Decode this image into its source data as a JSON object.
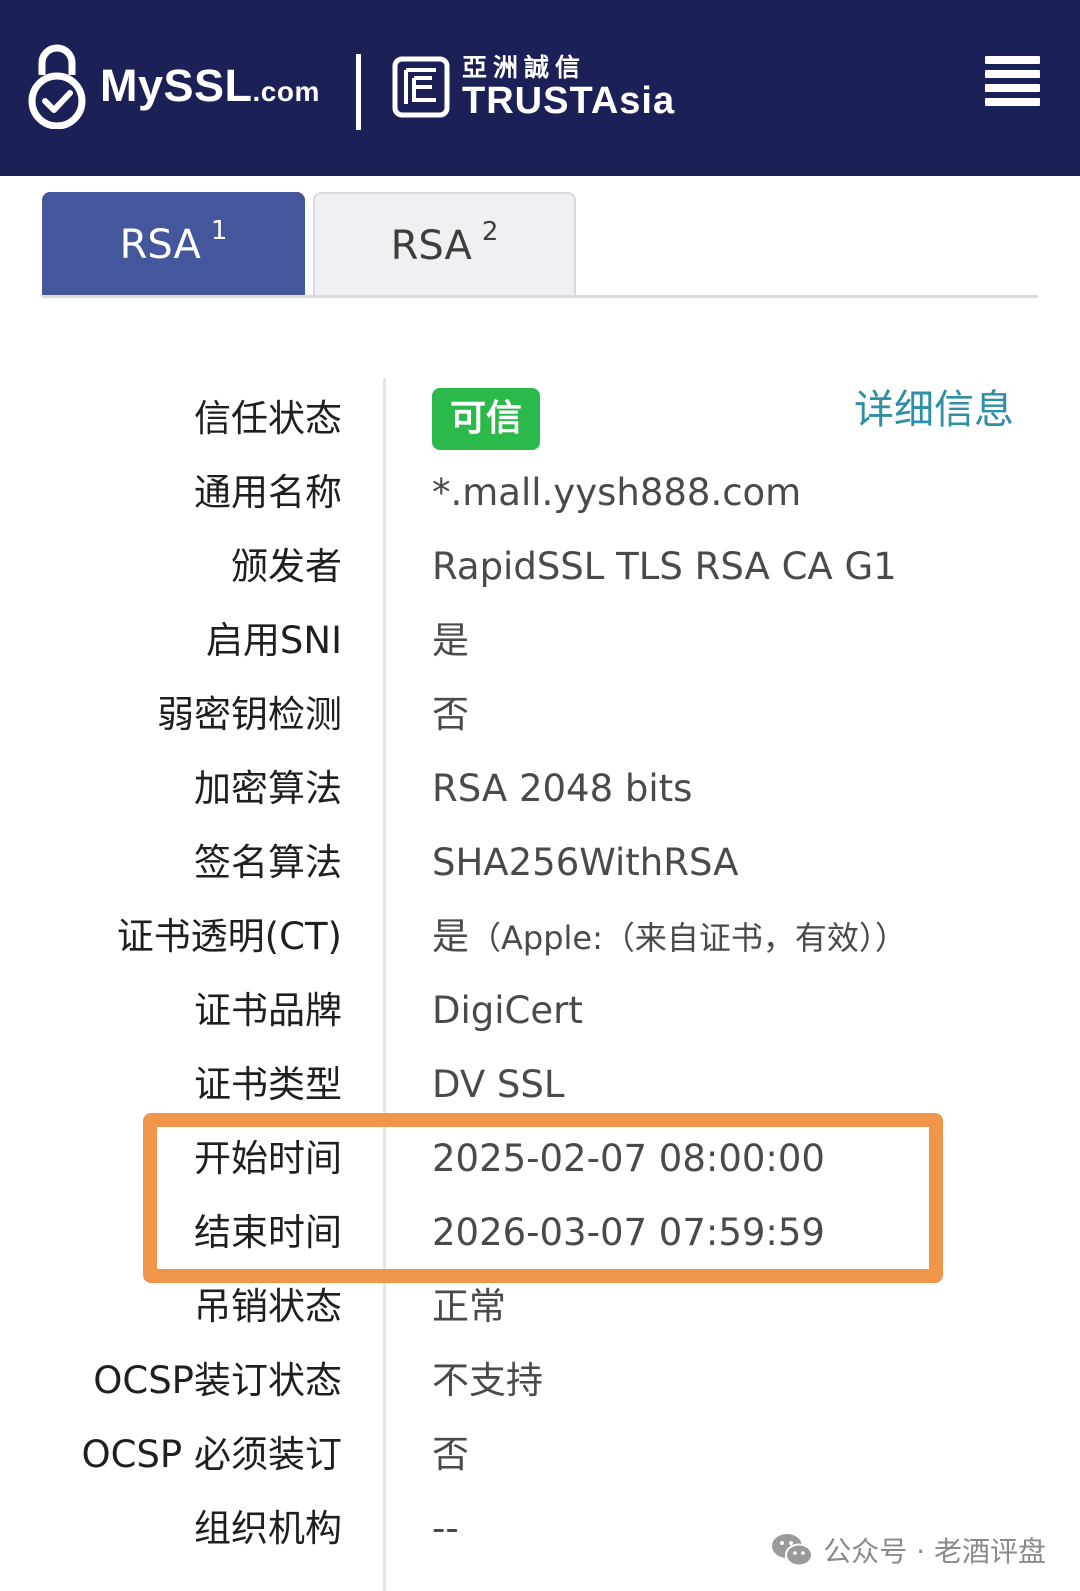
{
  "header": {
    "brand_name": "MySSL",
    "brand_suffix": ".com",
    "partner_cn": "亞洲誠信",
    "partner_en": "TRUSTAsia",
    "menu_icon": "menu-icon",
    "bg_color": "#1b2156"
  },
  "tabs": [
    {
      "label": "RSA",
      "sup": "1",
      "active": true
    },
    {
      "label": "RSA",
      "sup": "2",
      "active": false
    }
  ],
  "trust": {
    "label": "信任状态",
    "badge": "可信",
    "details_link": "详细信息"
  },
  "rows": [
    {
      "label": "通用名称",
      "value": "*.mall.yysh888.com"
    },
    {
      "label": "颁发者",
      "value": "RapidSSL TLS RSA CA G1"
    },
    {
      "label": "启用SNI",
      "value": "是"
    },
    {
      "label": "弱密钥检测",
      "value": "否"
    },
    {
      "label": "加密算法",
      "value": "RSA 2048 bits"
    },
    {
      "label": "签名算法",
      "value": "SHA256WithRSA"
    },
    {
      "label": "证书透明(CT)",
      "value": "是",
      "note": "（Apple:（来自证书，有效））"
    },
    {
      "label": "证书品牌",
      "value": "DigiCert"
    },
    {
      "label": "证书类型",
      "value": "DV SSL"
    },
    {
      "label": "开始时间",
      "value": "2025-02-07 08:00:00"
    },
    {
      "label": "结束时间",
      "value": "2026-03-07 07:59:59"
    },
    {
      "label": "吊销状态",
      "value": "正常"
    },
    {
      "label": "OCSP装订状态",
      "value": "不支持"
    },
    {
      "label": "OCSP 必须装订",
      "value": "否"
    },
    {
      "label": "组织机构",
      "value": "--"
    }
  ],
  "watermark": {
    "text": "公众号 · 老酒评盘",
    "icon": "wechat-icon"
  },
  "colors": {
    "tab_active": "#44579d",
    "badge_green": "#2ab94a",
    "link": "#2e8fa5",
    "highlight": "#f0964b"
  }
}
